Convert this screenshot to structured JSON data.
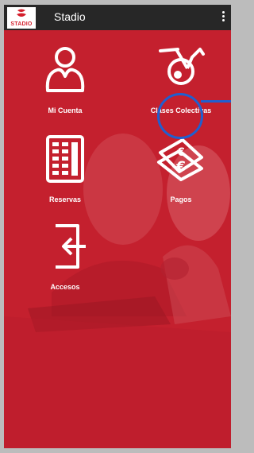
{
  "app": {
    "title": "Stadio",
    "logo_text": "STADIO",
    "menu_icon": "kebab-menu-icon"
  },
  "colors": {
    "appbar": "#272727",
    "brand_red": "#c4202e",
    "highlight_blue": "#1f5fd0"
  },
  "tiles": [
    {
      "label": "Mi Cuenta",
      "icon": "user-profile-icon"
    },
    {
      "label": "Clases Colectivas",
      "icon": "exercise-bike-icon"
    },
    {
      "label": "Reservas",
      "icon": "calendar-grid-icon"
    },
    {
      "label": "Pagos",
      "icon": "euro-banknote-icon"
    },
    {
      "label": "Accesos",
      "icon": "enter-door-icon"
    }
  ]
}
